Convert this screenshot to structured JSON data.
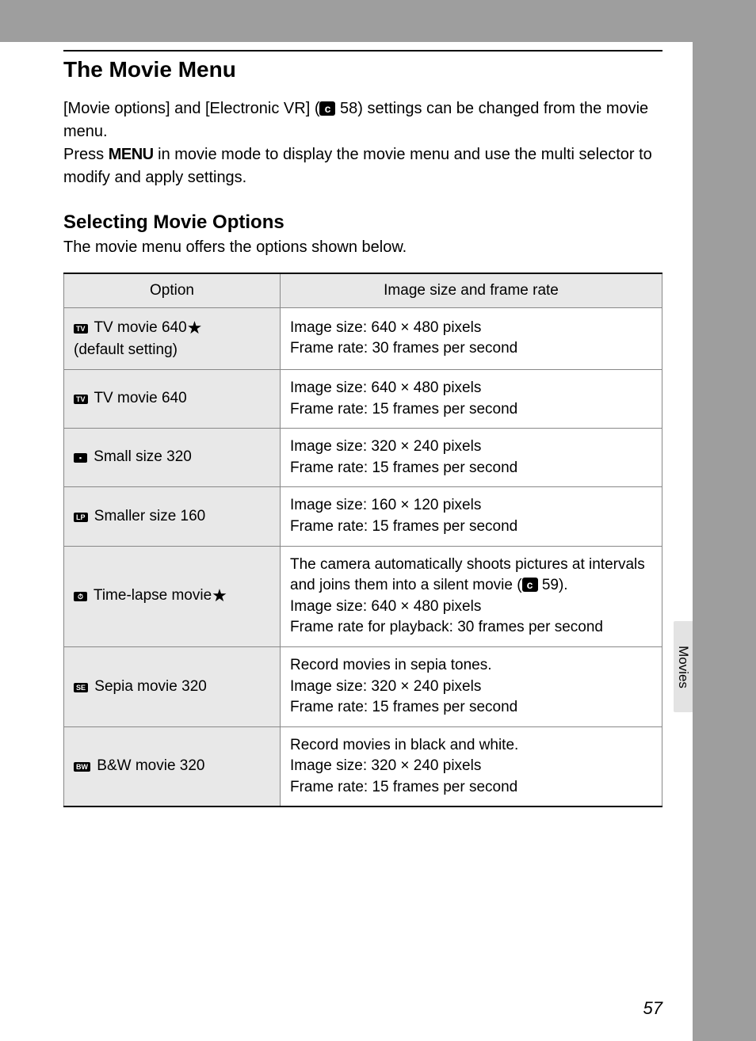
{
  "title": "The Movie Menu",
  "intro": {
    "part1": "[Movie options] and [Electronic VR] (",
    "ref1_icon": "c",
    "ref1_page": " 58",
    "part2": ") settings can be changed from the movie menu.",
    "part3a": "Press ",
    "menuLabel": "MENU",
    "part3b": " in movie mode to display the movie menu and use the multi selector to modify and apply settings."
  },
  "section2": {
    "heading": "Selecting Movie Options",
    "subtitle": "The movie menu offers the options shown below."
  },
  "table": {
    "headers": {
      "option": "Option",
      "desc": "Image size and frame rate"
    },
    "rows": [
      {
        "glyph": "TV",
        "label": " TV movie 640",
        "suffix": "★",
        "extra": "(default setting)",
        "desc": "Image size: 640 × 480 pixels\nFrame rate: 30 frames per second"
      },
      {
        "glyph": "TV",
        "label": " TV movie 640",
        "suffix": "",
        "extra": "",
        "desc": "Image size: 640 × 480 pixels\nFrame rate: 15 frames per second"
      },
      {
        "glyph": "▪",
        "label": " Small size 320",
        "suffix": "",
        "extra": "",
        "desc": "Image size: 320 × 240 pixels\nFrame rate: 15 frames per second"
      },
      {
        "glyph": "LP",
        "label": " Smaller size 160",
        "suffix": "",
        "extra": "",
        "desc": "Image size: 160 × 120 pixels\nFrame rate: 15 frames per second"
      },
      {
        "glyph": "⏱",
        "label": " Time-lapse movie",
        "suffix": "★",
        "extra": "",
        "desc_pre": "The camera automatically shoots pictures at intervals and joins them into a silent movie (",
        "desc_ref": "c",
        "desc_refpage": " 59",
        "desc_post": ").\nImage size: 640 × 480 pixels\nFrame rate for playback: 30 frames per second"
      },
      {
        "glyph": "SE",
        "label": " Sepia movie 320",
        "suffix": "",
        "extra": "",
        "desc": "Record movies in sepia tones.\nImage size: 320 × 240 pixels\nFrame rate: 15 frames per second"
      },
      {
        "glyph": "BW",
        "label": " B&W movie 320",
        "suffix": "",
        "extra": "",
        "desc": "Record movies in black and white.\nImage size: 320 × 240 pixels\nFrame rate: 15 frames per second"
      }
    ]
  },
  "sideTab": "Movies",
  "pageNumber": "57"
}
